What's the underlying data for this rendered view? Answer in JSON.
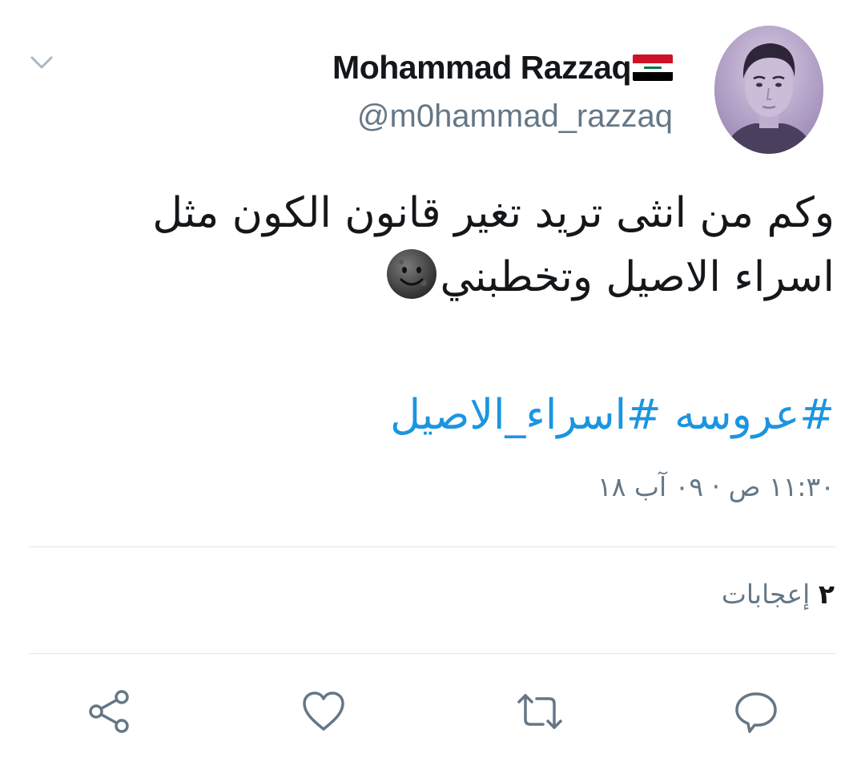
{
  "tweet": {
    "author": {
      "display_name": "Mohammad Razzaq",
      "handle": "@m0hammad_razzaq"
    },
    "text_line1": "وكم من انثى تريد تغير قانون الكون مثل",
    "text_line2": "اسراء الاصيل وتخطبني",
    "hashtags": [
      "#عروسه",
      "#اسراء_الاصيل"
    ],
    "timestamp": "١١:٣٠ ص · ٠٩ آب ١٨",
    "likes": {
      "count": "٢",
      "label": "إعجابات"
    }
  },
  "colors": {
    "link": "#1b95e0",
    "muted": "#657786",
    "divider": "#e1e8ed",
    "text": "#14171a"
  },
  "icons": {
    "menu": "chevron-down-icon",
    "reply": "reply-bubble-icon",
    "retweet": "retweet-icon",
    "like": "heart-icon",
    "share": "share-icon"
  }
}
